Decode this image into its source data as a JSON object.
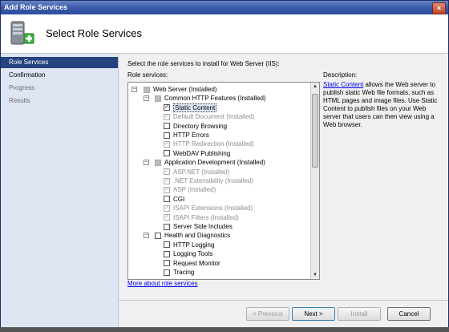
{
  "window": {
    "title": "Add Role Services",
    "close_label": "×"
  },
  "header": {
    "title": "Select Role Services"
  },
  "sidebar": {
    "items": [
      {
        "label": "Role Services",
        "state": "active"
      },
      {
        "label": "Confirmation",
        "state": "normal"
      },
      {
        "label": "Progress",
        "state": "inactive"
      },
      {
        "label": "Results",
        "state": "inactive"
      }
    ]
  },
  "main": {
    "instruction": "Select the role services to install for Web Server (IIS):",
    "role_services_label": "Role services:",
    "description_label": "Description:",
    "description_link": "Static Content",
    "description_text": " allows the Web server to publish static Web file formats, such as HTML pages and image files. Use Static Content to publish files on your Web server that users can then view using a Web browser.",
    "more_link": "More about role services"
  },
  "tree": [
    {
      "label": "Web Server  (Installed)",
      "level": 0,
      "expander": "minus",
      "check": "indeterminate",
      "disabled": false
    },
    {
      "label": "Common HTTP Features  (Installed)",
      "level": 1,
      "expander": "minus",
      "check": "indeterminate",
      "disabled": false
    },
    {
      "label": "Static Content",
      "level": 2,
      "check": "checked",
      "disabled": false,
      "selected": true
    },
    {
      "label": "Default Document  (Installed)",
      "level": 2,
      "check": "checked-grey",
      "disabled": true
    },
    {
      "label": "Directory Browsing",
      "level": 2,
      "check": "unchecked",
      "disabled": false
    },
    {
      "label": "HTTP Errors",
      "level": 2,
      "check": "unchecked",
      "disabled": false
    },
    {
      "label": "HTTP Redirection  (Installed)",
      "level": 2,
      "check": "checked-grey",
      "disabled": true
    },
    {
      "label": "WebDAV Publishing",
      "level": 2,
      "check": "unchecked",
      "disabled": false
    },
    {
      "label": "Application Development  (Installed)",
      "level": 1,
      "expander": "minus",
      "check": "indeterminate",
      "disabled": false
    },
    {
      "label": "ASP.NET  (Installed)",
      "level": 2,
      "check": "checked-grey",
      "disabled": true
    },
    {
      "label": ".NET Extensibility  (Installed)",
      "level": 2,
      "check": "checked-grey",
      "disabled": true
    },
    {
      "label": "ASP  (Installed)",
      "level": 2,
      "check": "checked-grey",
      "disabled": true
    },
    {
      "label": "CGI",
      "level": 2,
      "check": "unchecked",
      "disabled": false
    },
    {
      "label": "ISAPI Extensions  (Installed)",
      "level": 2,
      "check": "checked-grey",
      "disabled": true
    },
    {
      "label": "ISAPI Filters  (Installed)",
      "level": 2,
      "check": "checked-grey",
      "disabled": true
    },
    {
      "label": "Server Side Includes",
      "level": 2,
      "check": "unchecked",
      "disabled": false
    },
    {
      "label": "Health and Diagnostics",
      "level": 1,
      "expander": "minus",
      "check": "unchecked",
      "disabled": false
    },
    {
      "label": "HTTP Logging",
      "level": 2,
      "check": "unchecked",
      "disabled": false
    },
    {
      "label": "Logging Tools",
      "level": 2,
      "check": "unchecked",
      "disabled": false
    },
    {
      "label": "Request Monitor",
      "level": 2,
      "check": "unchecked",
      "disabled": false
    },
    {
      "label": "Tracing",
      "level": 2,
      "check": "unchecked",
      "disabled": false
    }
  ],
  "footer": {
    "previous": "< Previous",
    "next": "Next >",
    "install": "Install",
    "cancel": "Cancel"
  },
  "colors": {
    "sidebar_active": "#24437f",
    "link": "#0000ee",
    "title_bar": "#3a5aa8"
  }
}
